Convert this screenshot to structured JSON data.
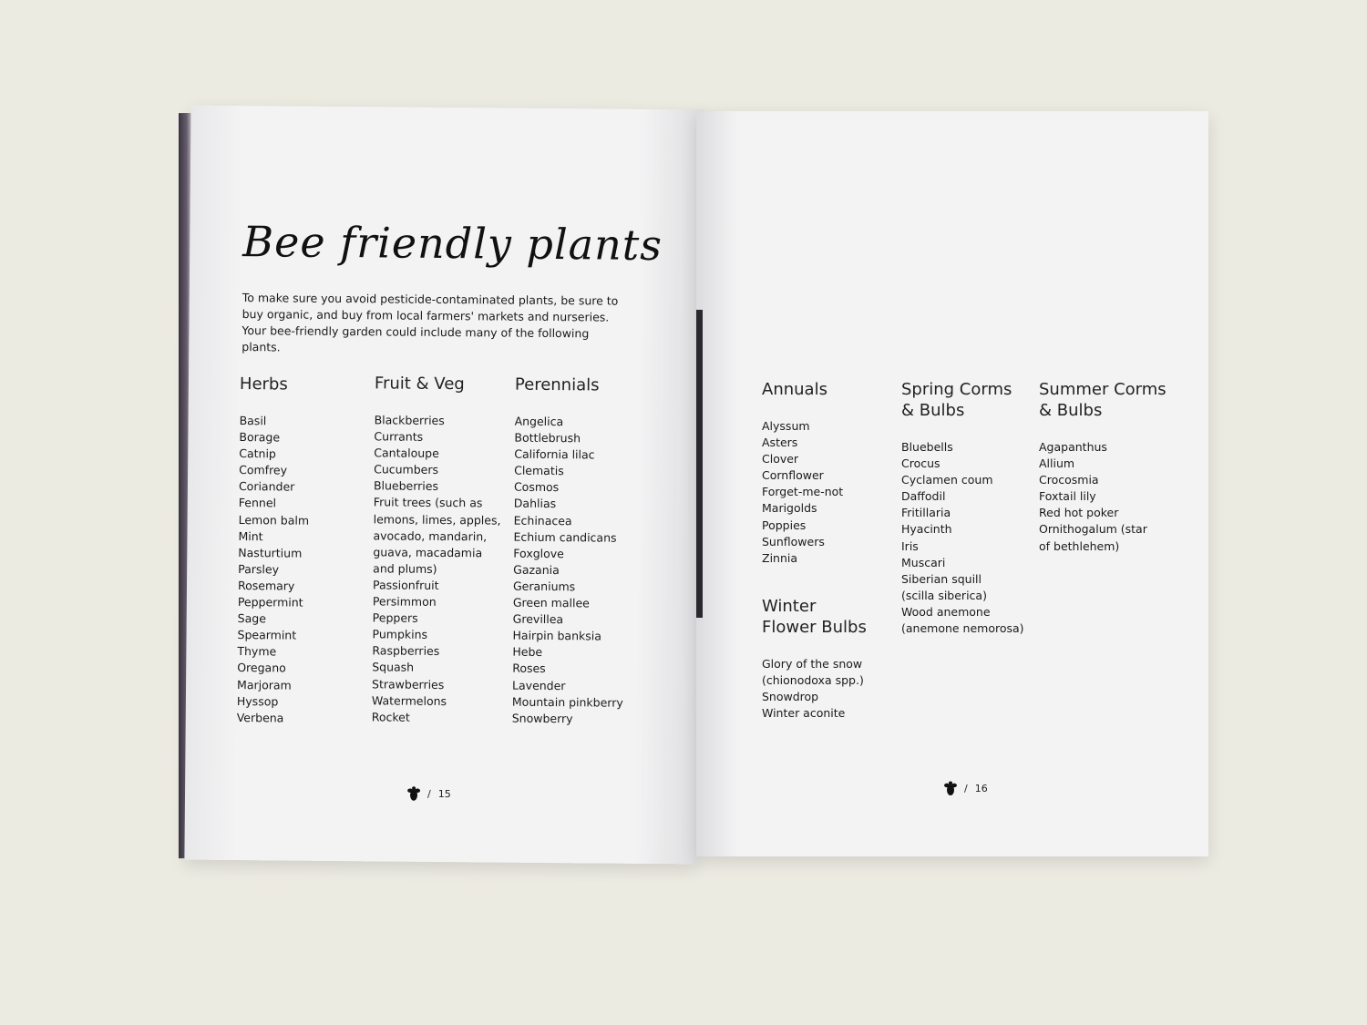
{
  "left_page": {
    "title": "Bee friendly plants",
    "intro": "To make sure you avoid pesticide-contaminated plants, be sure to buy organic, and buy from local farmers' markets and nurseries. Your bee-friendly garden could include many of the following plants.",
    "columns": [
      {
        "heading": "Herbs",
        "items": [
          "Basil",
          "Borage",
          "Catnip",
          "Comfrey",
          "Coriander",
          "Fennel",
          "Lemon balm",
          "Mint",
          "Nasturtium",
          "Parsley",
          "Rosemary",
          "Peppermint",
          "Sage",
          "Spearmint",
          "Thyme",
          "Oregano",
          "Marjoram",
          "Hyssop",
          "Verbena"
        ]
      },
      {
        "heading": "Fruit & Veg",
        "items": [
          "Blackberries",
          "Currants",
          "Cantaloupe",
          "Cucumbers",
          "Blueberries",
          "Fruit trees (such as",
          "lemons, limes, apples,",
          "avocado, mandarin,",
          "guava, macadamia",
          "and plums)",
          "Passionfruit",
          "Persimmon",
          "Peppers",
          "Pumpkins",
          "Raspberries",
          "Squash",
          "Strawberries",
          "Watermelons",
          "Rocket"
        ]
      },
      {
        "heading": "Perennials",
        "items": [
          "Angelica",
          "Bottlebrush",
          "California lilac",
          "Clematis",
          "Cosmos",
          "Dahlias",
          "Echinacea",
          "Echium candicans",
          "Foxglove",
          "Gazania",
          "Geraniums",
          "Green mallee",
          "Grevillea",
          "Hairpin banksia",
          "Hebe",
          "Roses",
          "Lavender",
          "Mountain pinkberry",
          "Snowberry"
        ]
      }
    ],
    "page_number": "15"
  },
  "right_page": {
    "columns": [
      {
        "heading": "Annuals",
        "items": [
          "Alyssum",
          "Asters",
          "Clover",
          "Cornflower",
          "Forget-me-not",
          "Marigolds",
          "Poppies",
          "Sunflowers",
          "Zinnia"
        ]
      },
      {
        "heading_lines": [
          "Spring Corms",
          "& Bulbs"
        ],
        "items": [
          "Bluebells",
          "Crocus",
          "Cyclamen coum",
          "Daffodil",
          "Fritillaria",
          "Hyacinth",
          "Iris",
          "Muscari",
          "Siberian squill",
          "(scilla siberica)",
          "Wood anemone",
          "(anemone nemorosa)"
        ]
      },
      {
        "heading_lines": [
          "Summer Corms",
          "& Bulbs"
        ],
        "items": [
          "Agapanthus",
          "Allium",
          "Crocosmia",
          "Foxtail lily",
          "Red hot poker",
          "Ornithogalum (star",
          "of bethlehem)"
        ]
      },
      {
        "heading_lines": [
          "Winter",
          "Flower Bulbs"
        ],
        "items": [
          "Glory of the snow",
          "(chionodoxa spp.)",
          "Snowdrop",
          "Winter aconite"
        ]
      }
    ],
    "page_number": "16"
  },
  "folio_separator": "/",
  "icons": {
    "folio": "bee-icon"
  }
}
